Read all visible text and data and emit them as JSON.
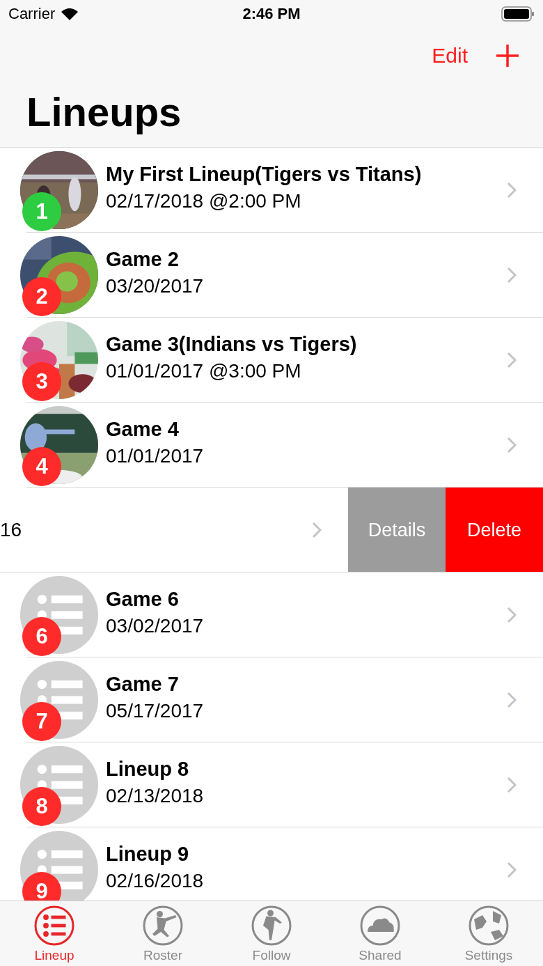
{
  "status_bar": {
    "carrier": "Carrier",
    "time": "2:46 PM"
  },
  "nav": {
    "edit": "Edit",
    "title": "Lineups"
  },
  "rows": [
    {
      "number": "1",
      "color": "#2ecc40",
      "title": "My First Lineup(Tigers vs Titans)",
      "date": "02/17/2018 @2:00 PM"
    },
    {
      "number": "2",
      "color": "#ff2a2a",
      "title": "Game 2",
      "date": "03/20/2017"
    },
    {
      "number": "3",
      "color": "#ff2a2a",
      "title": "Game 3(Indians vs Tigers)",
      "date": "01/01/2017 @3:00 PM"
    },
    {
      "number": "4",
      "color": "#ff2a2a",
      "title": "Game 4",
      "date": "01/01/2017"
    },
    {
      "kind": "swiped",
      "date": "16",
      "actions": [
        "Details",
        "Delete"
      ]
    },
    {
      "kind": "placeholder",
      "number": "6",
      "color": "#ff2a2a",
      "title": "Game 6",
      "date": "03/02/2017"
    },
    {
      "kind": "placeholder",
      "number": "7",
      "color": "#ff2a2a",
      "title": "Game 7",
      "date": "05/17/2017"
    },
    {
      "kind": "placeholder",
      "number": "8",
      "color": "#ff2a2a",
      "title": "Lineup 8",
      "date": "02/13/2018"
    },
    {
      "kind": "placeholder",
      "number": "9",
      "color": "#ff2a2a",
      "title": "Lineup 9",
      "date": "02/16/2018"
    }
  ],
  "tabs": [
    {
      "label": "Lineup",
      "selected": true
    },
    {
      "label": "Roster",
      "selected": false
    },
    {
      "label": "Follow",
      "selected": false
    },
    {
      "label": "Shared",
      "selected": false
    },
    {
      "label": "Settings",
      "selected": false
    }
  ]
}
